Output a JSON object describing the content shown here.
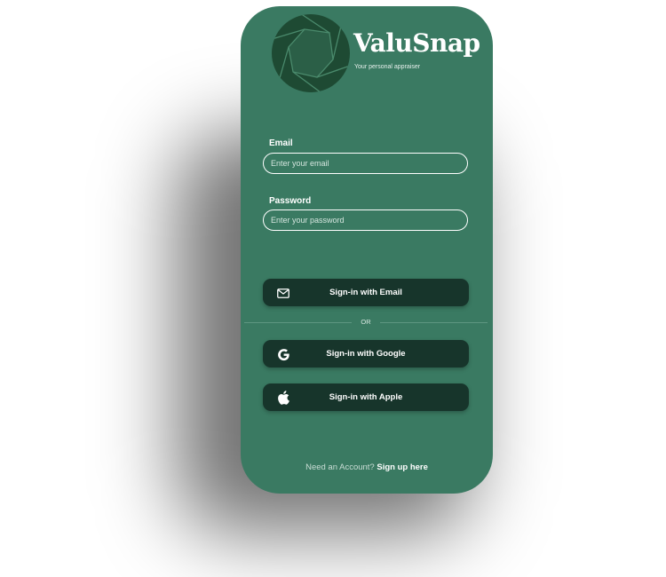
{
  "brand": {
    "name": "ValuSnap",
    "tagline": "Your personal appraiser",
    "logo_icon": "camera-aperture-icon"
  },
  "form": {
    "email_label": "Email",
    "email_placeholder": "Enter your email",
    "email_value": "",
    "password_label": "Password",
    "password_placeholder": "Enter your password",
    "password_value": ""
  },
  "buttons": {
    "email": {
      "label": "Sign-in with Email",
      "icon": "envelope-icon"
    },
    "google": {
      "label": "Sign-in with Google",
      "icon": "google-icon"
    },
    "apple": {
      "label": "Sign-in with Apple",
      "icon": "apple-icon"
    }
  },
  "divider": {
    "label": "OR"
  },
  "footer": {
    "prompt": "Need an Account?",
    "link": "Sign up here"
  },
  "colors": {
    "background": "#3a7a62",
    "button": "#17352b",
    "logo_dark": "#1e4a33",
    "text": "#ffffff"
  }
}
